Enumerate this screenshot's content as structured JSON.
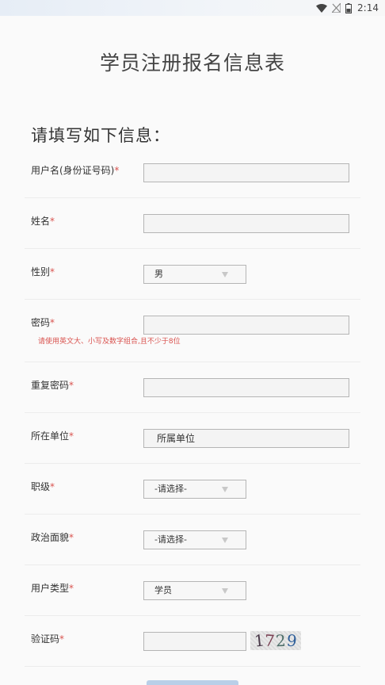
{
  "status_bar": {
    "time": "2:14",
    "icons": [
      "wifi-icon",
      "signal-icon",
      "battery-icon"
    ]
  },
  "page_title": "学员注册报名信息表",
  "section_heading": "请填写如下信息：",
  "required_mark": "*",
  "fields": {
    "username": {
      "label": "用户名(身份证号码)",
      "value": ""
    },
    "name": {
      "label": "姓名",
      "value": ""
    },
    "gender": {
      "label": "性别",
      "selected": "男"
    },
    "password": {
      "label": "密码",
      "value": "",
      "hint": "请使用英文大、小写及数字组合,且不少于8位"
    },
    "confirm_password": {
      "label": "重复密码",
      "value": ""
    },
    "organization": {
      "label": "所在单位",
      "value": "所属单位"
    },
    "rank": {
      "label": "职级",
      "selected": "-请选择-"
    },
    "political_status": {
      "label": "政治面貌",
      "selected": "-请选择-"
    },
    "user_type": {
      "label": "用户类型",
      "selected": "学员"
    },
    "captcha": {
      "label": "验证码",
      "value": "",
      "image_text": [
        "1",
        "7",
        "2",
        "9"
      ]
    }
  },
  "colors": {
    "required": "#d9534f",
    "input_border": "#b5b5b5",
    "submit_button": "#b9cfe8"
  }
}
